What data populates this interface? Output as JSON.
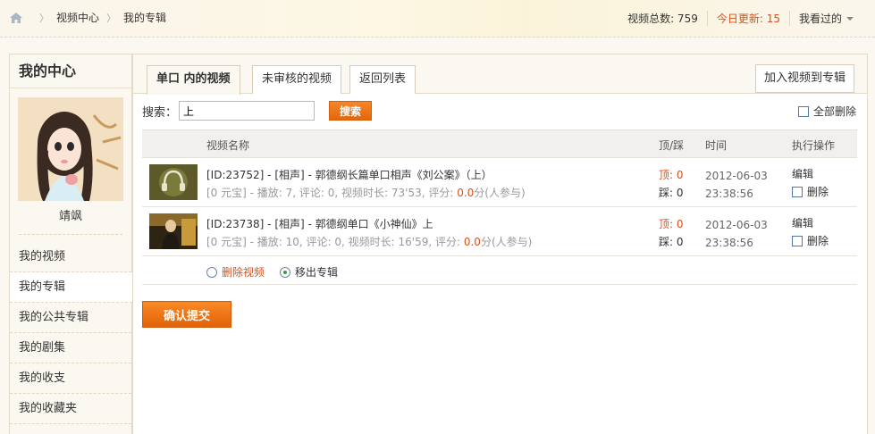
{
  "breadcrumb": {
    "home_icon": "home-icon",
    "items": [
      "视频中心",
      "我的专辑"
    ]
  },
  "stats": {
    "total_label": "视频总数: 759",
    "today_label": "今日更新: 15",
    "seen_label": "我看过的"
  },
  "sidebar": {
    "title": "我的中心",
    "user_name": "靖飒",
    "items": [
      "我的视频",
      "我的专辑",
      "我的公共专辑",
      "我的剧集",
      "我的收支",
      "我的收藏夹"
    ],
    "active_index": 1
  },
  "tabs": [
    "单口 内的视频",
    "未审核的视频",
    "返回列表"
  ],
  "add_button": "加入视频到专辑",
  "search": {
    "label": "搜索：",
    "value": "上",
    "button": "搜索"
  },
  "delete_all_label": "全部删除",
  "table": {
    "headers": {
      "name": "视频名称",
      "updown": "顶/踩",
      "time": "时间",
      "ops": "执行操作"
    },
    "rows": [
      {
        "title": "[ID:23752] - [相声] - 郭德纲长篇单口相声《刘公案》（上）",
        "meta_prefix": "[0 元宝] - 播放: 7, 评论: 0, 视频时长: 73'53, 评分: ",
        "score": "0.0",
        "meta_suffix": "分(人参与)",
        "up": "顶: 0",
        "down": "踩: 0",
        "date": "2012-06-03",
        "clock": "23:38:56",
        "edit": "编辑",
        "delete": "删除"
      },
      {
        "title": "[ID:23738] - [相声] - 郭德纲单口《小神仙》上",
        "meta_prefix": "[0 元宝] - 播放: 10, 评论: 0, 视频时长: 16'59, 评分: ",
        "score": "0.0",
        "meta_suffix": "分(人参与)",
        "up": "顶: 0",
        "down": "踩: 0",
        "date": "2012-06-03",
        "clock": "23:38:56",
        "edit": "编辑",
        "delete": "删除"
      }
    ]
  },
  "actions": {
    "delete_video": "删除视频",
    "move_out": "移出专辑"
  },
  "confirm_button": "确认提交"
}
